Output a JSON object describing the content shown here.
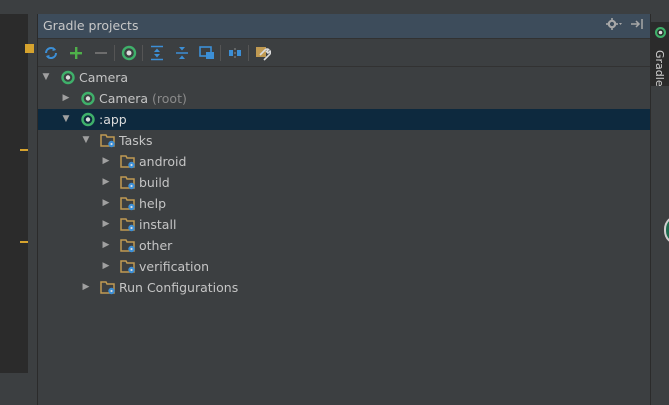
{
  "panel": {
    "title": "Gradle projects",
    "settings_icon": "gear-icon",
    "hide_icon": "pin-right-icon"
  },
  "toolbar": {
    "buttons": [
      {
        "name": "refresh-all-button",
        "icon": "sync-icon"
      },
      {
        "name": "add-project-button",
        "icon": "plus-icon"
      },
      {
        "name": "remove-project-button",
        "icon": "minus-icon"
      },
      {
        "name": "execute-task-button",
        "icon": "gradle-icon"
      },
      {
        "name": "expand-all-button",
        "icon": "expand-all-icon"
      },
      {
        "name": "collapse-all-button",
        "icon": "collapse-all-icon"
      },
      {
        "name": "attach-button",
        "icon": "attach-icon"
      },
      {
        "name": "toggle-offline-button",
        "icon": "offline-icon"
      },
      {
        "name": "settings-button",
        "icon": "wrench-icon"
      }
    ]
  },
  "tree": {
    "camera": "Camera",
    "camera_root": "Camera",
    "camera_root_suffix": "(root)",
    "app": ":app",
    "tasks": "Tasks",
    "task_groups": [
      "android",
      "build",
      "help",
      "install",
      "other",
      "verification"
    ],
    "run_configurations": "Run Configurations"
  },
  "right_bar": {
    "tab_label": "Gradle"
  },
  "colors": {
    "selection": "#0d293e",
    "gradle_green": "#3fb06a",
    "folder": "#c09a52",
    "accent_blue": "#3c8fd6"
  }
}
